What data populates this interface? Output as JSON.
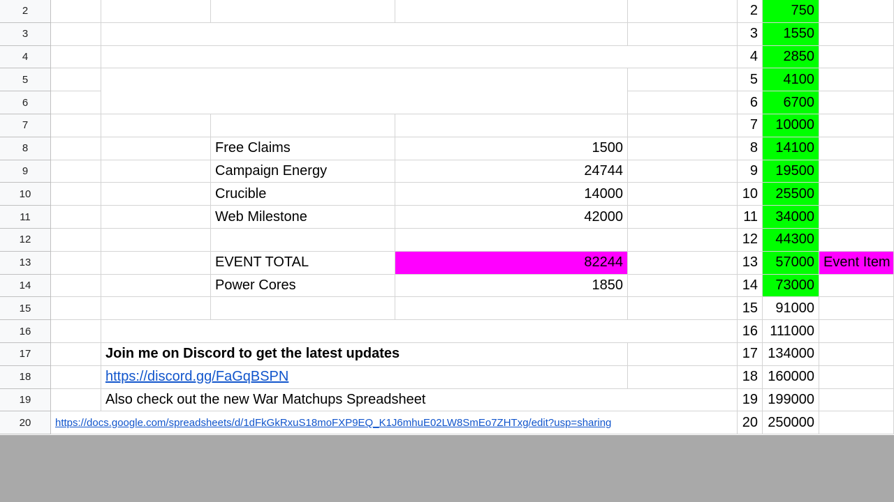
{
  "row_numbers": [
    "2",
    "3",
    "4",
    "5",
    "6",
    "7",
    "8",
    "9",
    "10",
    "11",
    "12",
    "13",
    "14",
    "15",
    "16",
    "17",
    "18",
    "19",
    "20"
  ],
  "summary": {
    "free_claims_label": "Free Claims",
    "free_claims_value": "1500",
    "campaign_energy_label": "Campaign Energy",
    "campaign_energy_value": "24744",
    "crucible_label": "Crucible",
    "crucible_value": "14000",
    "web_milestone_label": "Web Milestone",
    "web_milestone_value": "42000",
    "event_total_label": "EVENT TOTAL",
    "event_total_value": "82244",
    "power_cores_label": "Power Cores",
    "power_cores_value": "1850"
  },
  "notes": {
    "discord_text": "Join me on Discord to get the latest updates",
    "discord_link": "https://discord.gg/FaGqBSPN",
    "war_text": "Also check out the new War Matchups Spreadsheet",
    "war_link": "https://docs.google.com/spreadsheets/d/1dFkGkRxuS18moFXP9EQ_K1J6mhuE02LW8SmEo7ZHTxg/edit?usp=sharing"
  },
  "levels": [
    {
      "level": "2",
      "points": "750",
      "reached": true
    },
    {
      "level": "3",
      "points": "1550",
      "reached": true
    },
    {
      "level": "4",
      "points": "2850",
      "reached": true
    },
    {
      "level": "5",
      "points": "4100",
      "reached": true
    },
    {
      "level": "6",
      "points": "6700",
      "reached": true
    },
    {
      "level": "7",
      "points": "10000",
      "reached": true
    },
    {
      "level": "8",
      "points": "14100",
      "reached": true
    },
    {
      "level": "9",
      "points": "19500",
      "reached": true
    },
    {
      "level": "10",
      "points": "25500",
      "reached": true
    },
    {
      "level": "11",
      "points": "34000",
      "reached": true
    },
    {
      "level": "12",
      "points": "44300",
      "reached": true
    },
    {
      "level": "13",
      "points": "57000",
      "reached": true
    },
    {
      "level": "14",
      "points": "73000",
      "reached": true
    },
    {
      "level": "15",
      "points": "91000",
      "reached": false
    },
    {
      "level": "16",
      "points": "111000",
      "reached": false
    },
    {
      "level": "17",
      "points": "134000",
      "reached": false
    },
    {
      "level": "18",
      "points": "160000",
      "reached": false
    },
    {
      "level": "19",
      "points": "199000",
      "reached": false
    },
    {
      "level": "20",
      "points": "250000",
      "reached": false
    }
  ],
  "event_item_label": "Event Item",
  "colors": {
    "reached": "#00ff00",
    "highlight": "#ff00ff",
    "link": "#1155cc",
    "background": "#a9a9a9"
  }
}
